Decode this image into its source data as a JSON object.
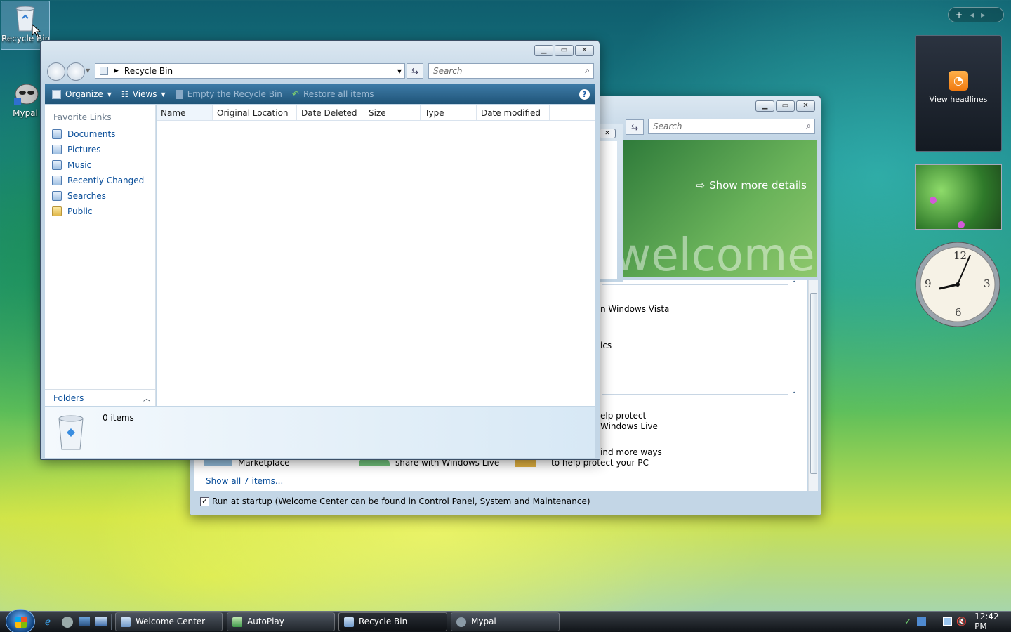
{
  "desktop": {
    "icons": [
      {
        "label": "Recycle Bin",
        "icon": "recycle-bin-icon"
      },
      {
        "label": "Mypal",
        "icon": "mypal-icon"
      }
    ]
  },
  "recycle_bin": {
    "address": "Recycle Bin",
    "search_placeholder": "Search",
    "toolbar": {
      "organize": "Organize",
      "views": "Views",
      "empty": "Empty the Recycle Bin",
      "restore": "Restore all items"
    },
    "favorite_links_title": "Favorite Links",
    "links": [
      "Documents",
      "Pictures",
      "Music",
      "Recently Changed",
      "Searches",
      "Public"
    ],
    "folders_label": "Folders",
    "columns": [
      "Name",
      "Original Location",
      "Date Deleted",
      "Size",
      "Type",
      "Date modified"
    ],
    "status": "0 items"
  },
  "welcome_center": {
    "search_placeholder": "Search",
    "show_details": "Show more details",
    "banner_word": "welcome",
    "items": [
      "n Windows Vista",
      "ics"
    ],
    "offers": [
      "elp protect",
      "Windows Live",
      "ind more ways",
      "to help protect your PC",
      "Marketplace",
      "share with Windows Live"
    ],
    "show_all": "Show all 7 items...",
    "startup_label": "Run at startup (Welcome Center can be found in Control Panel, System and Maintenance)"
  },
  "sidebar_gadgets": {
    "feed_label": "View headlines"
  },
  "taskbar": {
    "tasks": [
      "Welcome Center",
      "AutoPlay",
      "Recycle Bin",
      "Mypal"
    ],
    "clock": "12:42 PM"
  },
  "colors": {
    "link": "#0b4f9a",
    "toolbar": "#2b5f87",
    "taskbar": "#1b1f24"
  }
}
